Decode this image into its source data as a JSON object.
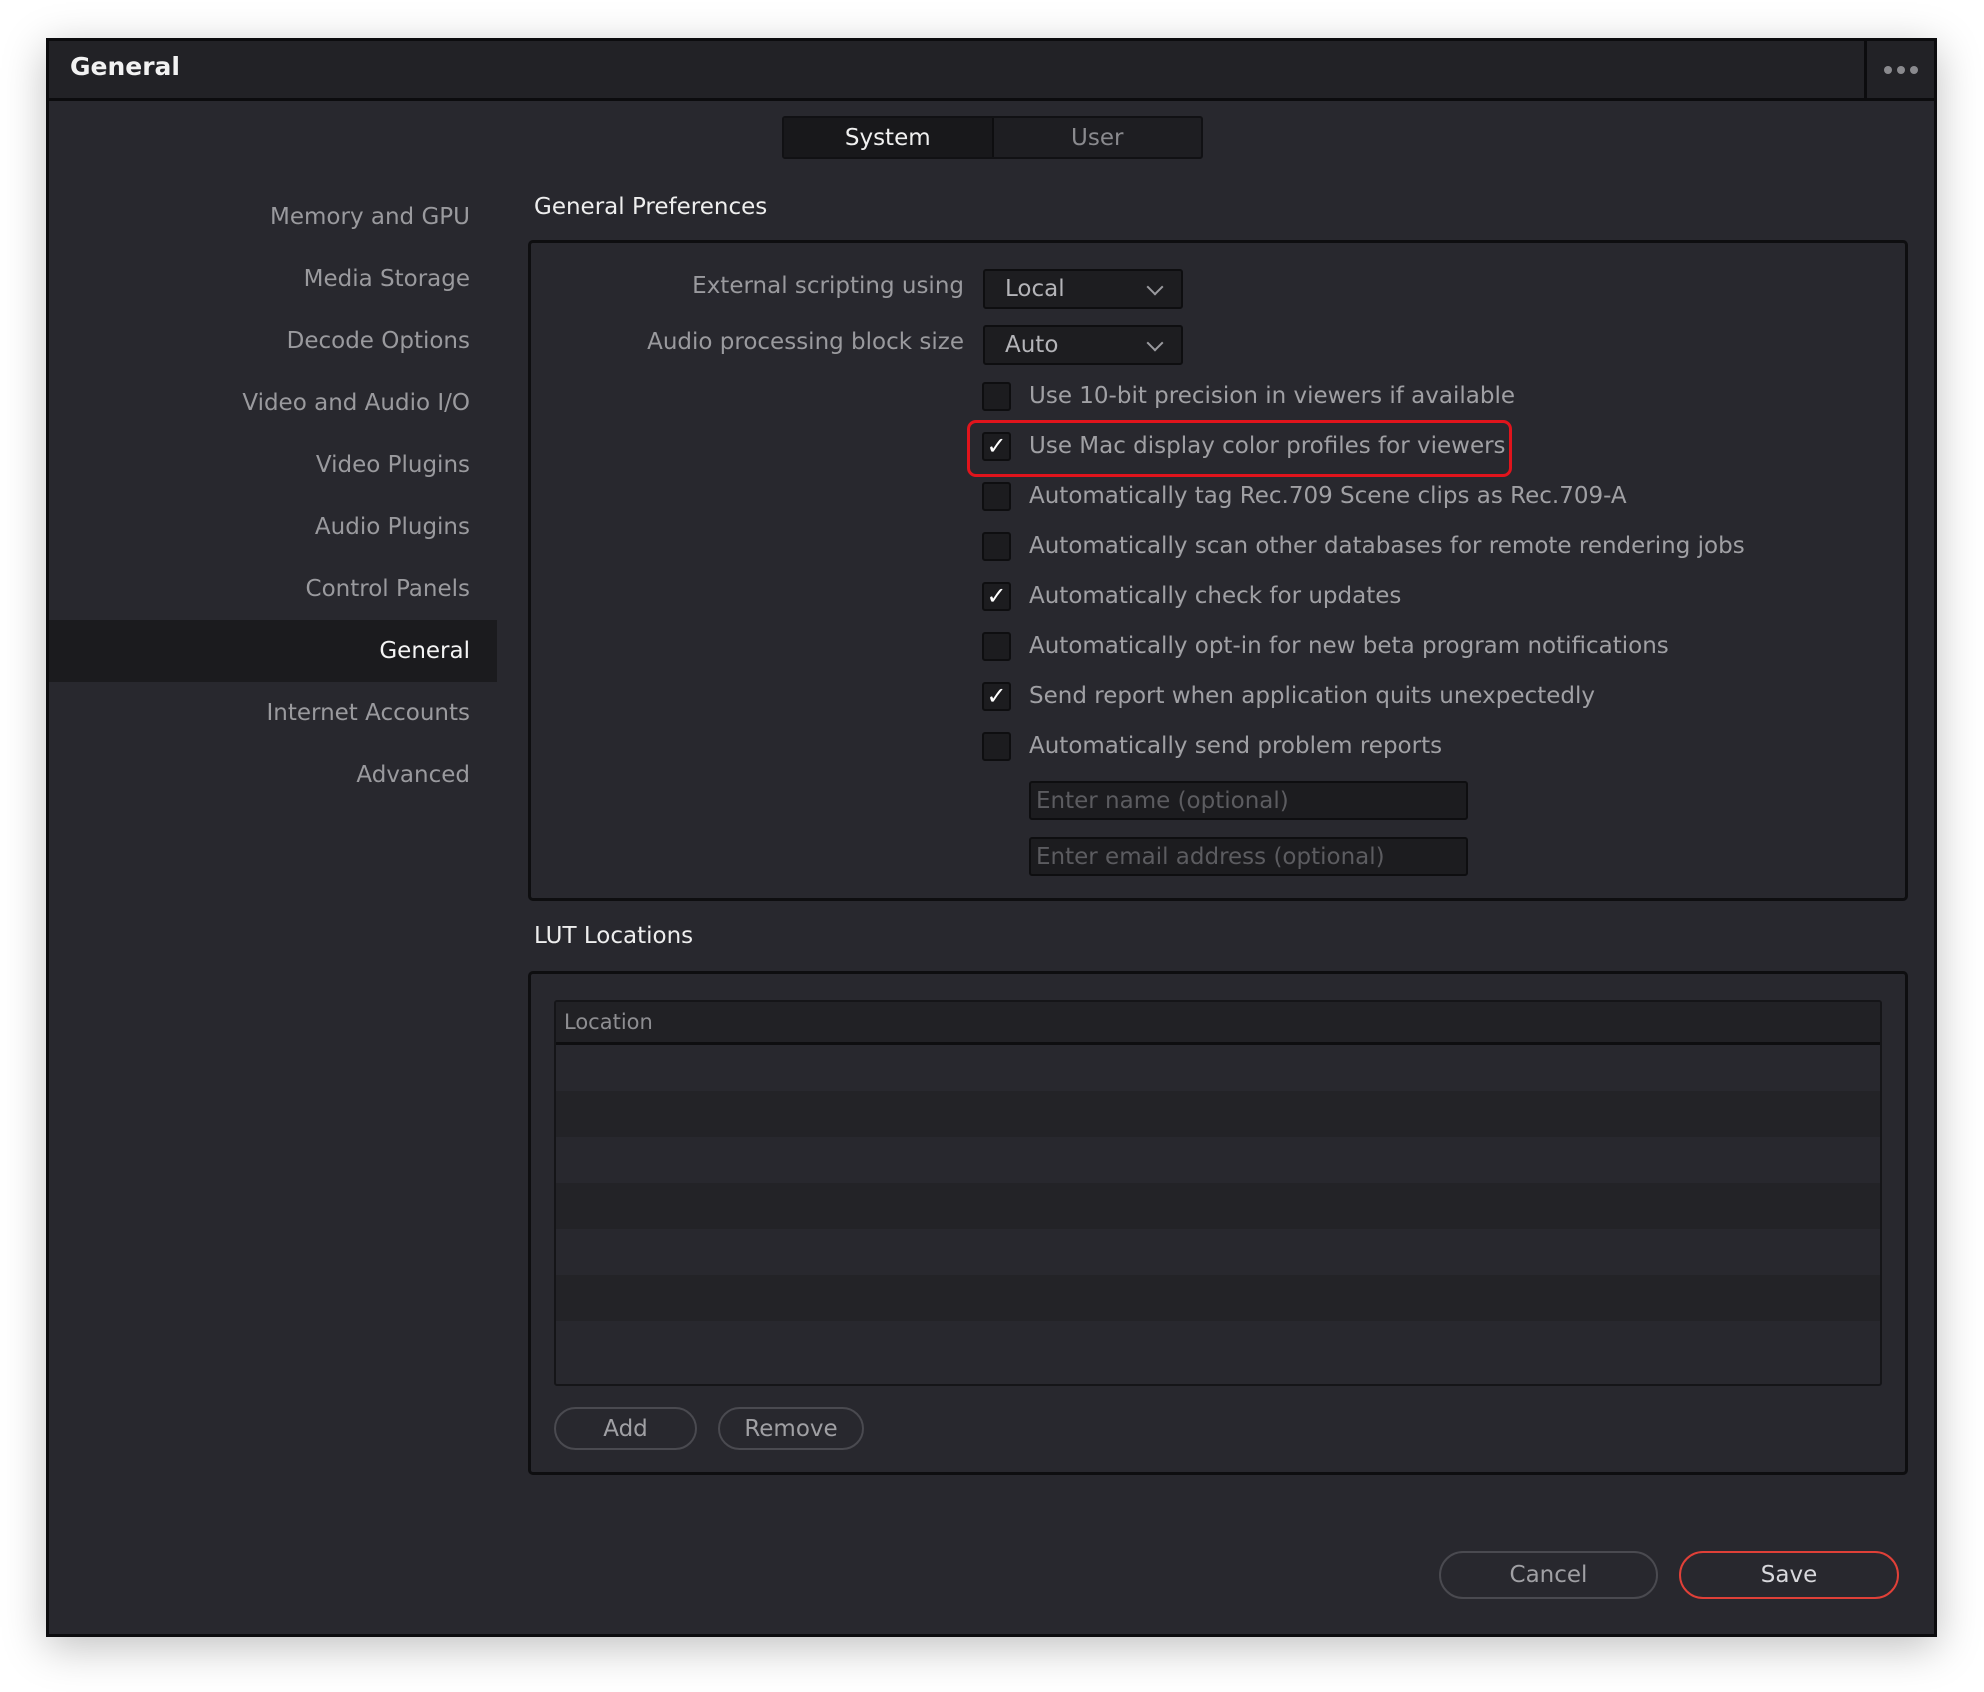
{
  "window": {
    "title": "General",
    "menu_icon": "more-horizontal-icon"
  },
  "tabs": [
    {
      "label": "System",
      "active": true
    },
    {
      "label": "User",
      "active": false
    }
  ],
  "sidebar": {
    "items": [
      {
        "label": "Memory and GPU"
      },
      {
        "label": "Media Storage"
      },
      {
        "label": "Decode Options"
      },
      {
        "label": "Video and Audio I/O"
      },
      {
        "label": "Video Plugins"
      },
      {
        "label": "Audio Plugins"
      },
      {
        "label": "Control Panels"
      },
      {
        "label": "General",
        "selected": true
      },
      {
        "label": "Internet Accounts"
      },
      {
        "label": "Advanced"
      }
    ]
  },
  "general_preferences": {
    "title": "General Preferences",
    "external_scripting": {
      "label": "External scripting using",
      "value": "Local"
    },
    "audio_block_size": {
      "label": "Audio processing block size",
      "value": "Auto"
    },
    "checkboxes": [
      {
        "label": "Use 10-bit precision in viewers if available",
        "checked": false
      },
      {
        "label": "Use Mac display color profiles for viewers",
        "checked": true,
        "highlighted": true
      },
      {
        "label": "Automatically tag Rec.709 Scene clips as Rec.709-A",
        "checked": false
      },
      {
        "label": "Automatically scan other databases for remote rendering jobs",
        "checked": false
      },
      {
        "label": "Automatically check for updates",
        "checked": true
      },
      {
        "label": "Automatically opt-in for new beta program notifications",
        "checked": false
      },
      {
        "label": "Send report when application quits unexpectedly",
        "checked": true
      },
      {
        "label": "Automatically send problem reports",
        "checked": false
      }
    ],
    "name_input": {
      "value": "",
      "placeholder": "Enter name (optional)"
    },
    "email_input": {
      "value": "",
      "placeholder": "Enter email address (optional)"
    },
    "check_glyph": "✓",
    "highlight_color": "#e0141c"
  },
  "lut_locations": {
    "title": "LUT Locations",
    "columns": [
      "Location"
    ],
    "rows": [],
    "add_label": "Add",
    "remove_label": "Remove"
  },
  "footer": {
    "cancel_label": "Cancel",
    "save_label": "Save",
    "save_accent": "#e04038"
  }
}
